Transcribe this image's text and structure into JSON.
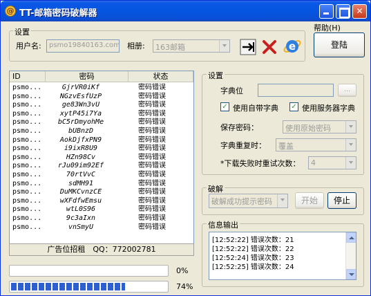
{
  "window": {
    "title": "TT-邮箱密码破解器"
  },
  "help_menu": "帮助(H)",
  "settings_top": {
    "group_title": "设置",
    "username_label": "用户名:",
    "username_value": "psmo19840163.com",
    "mailbox_label": "相册:",
    "mailbox_value": "163邮箱",
    "login_label": "登陆"
  },
  "list": {
    "columns": [
      "ID",
      "密码",
      "状态"
    ],
    "rows": [
      {
        "id": "psmo...",
        "password": "GjrVR0iKf",
        "status": "密码错误"
      },
      {
        "id": "psmo...",
        "password": "NGzvEsfUzP",
        "status": "密码错误"
      },
      {
        "id": "psmo...",
        "password": "ge83Wn3vU",
        "status": "密码错误"
      },
      {
        "id": "psmo...",
        "password": "xytP45i7Ya",
        "status": "密码错误"
      },
      {
        "id": "psmo...",
        "password": "bC5rDmyohMe",
        "status": "密码错误"
      },
      {
        "id": "psmo...",
        "password": "bUBnzD",
        "status": "密码错误"
      },
      {
        "id": "psmo...",
        "password": "AokDjfxPN9",
        "status": "密码错误"
      },
      {
        "id": "psmo...",
        "password": "i9ixR8U9",
        "status": "密码错误"
      },
      {
        "id": "psmo...",
        "password": "HZn98Cv",
        "status": "密码错误"
      },
      {
        "id": "psmo...",
        "password": "rJu09im92Ef",
        "status": "密码错误"
      },
      {
        "id": "psmo...",
        "password": "70rtVvC",
        "status": "密码错误"
      },
      {
        "id": "psmo...",
        "password": "sdMH91",
        "status": "密码错误"
      },
      {
        "id": "psmo...",
        "password": "DuMKCvnzCE",
        "status": "密码错误"
      },
      {
        "id": "psmo...",
        "password": "wXFdfwEmsu",
        "status": "密码错误"
      },
      {
        "id": "psmo...",
        "password": "wtL0S96",
        "status": "密码错误"
      },
      {
        "id": "psmo...",
        "password": "9c3aIxn",
        "status": "密码错误"
      },
      {
        "id": "psmo...",
        "password": "vnSmyU",
        "status": "密码错误"
      }
    ],
    "footer": "广告位招租　QQ：772002781"
  },
  "settings_right": {
    "group_title": "设置",
    "dict_label": "字典位",
    "browse_label": "...",
    "use_builtin_dict": "使用自带字典",
    "use_server_dict": "使用服务器字典",
    "save_pwd_label": "保存密码：",
    "save_pwd_value": "使用原始密码",
    "dict_repeat_label": "字典重复时：",
    "dict_repeat_value": "覆盖",
    "retry_label": "*下载失败时重试次数：",
    "retry_value": "4"
  },
  "crack": {
    "group_title": "破解",
    "mode_value": "破解成功提示密码",
    "start_label": "开始",
    "stop_label": "停止"
  },
  "info": {
    "group_title": "信息输出",
    "lines": [
      "[12:52:22] 错误次数：21",
      "[12:52:22] 错误次数：22",
      "[12:52:24] 错误次数：23",
      "[12:52:25] 错误次数：24"
    ]
  },
  "progress": {
    "p1_label": "0%",
    "p1_value": 0,
    "p2_label": "74%",
    "p2_value": 74,
    "fill_color": "#2d5fd0"
  }
}
